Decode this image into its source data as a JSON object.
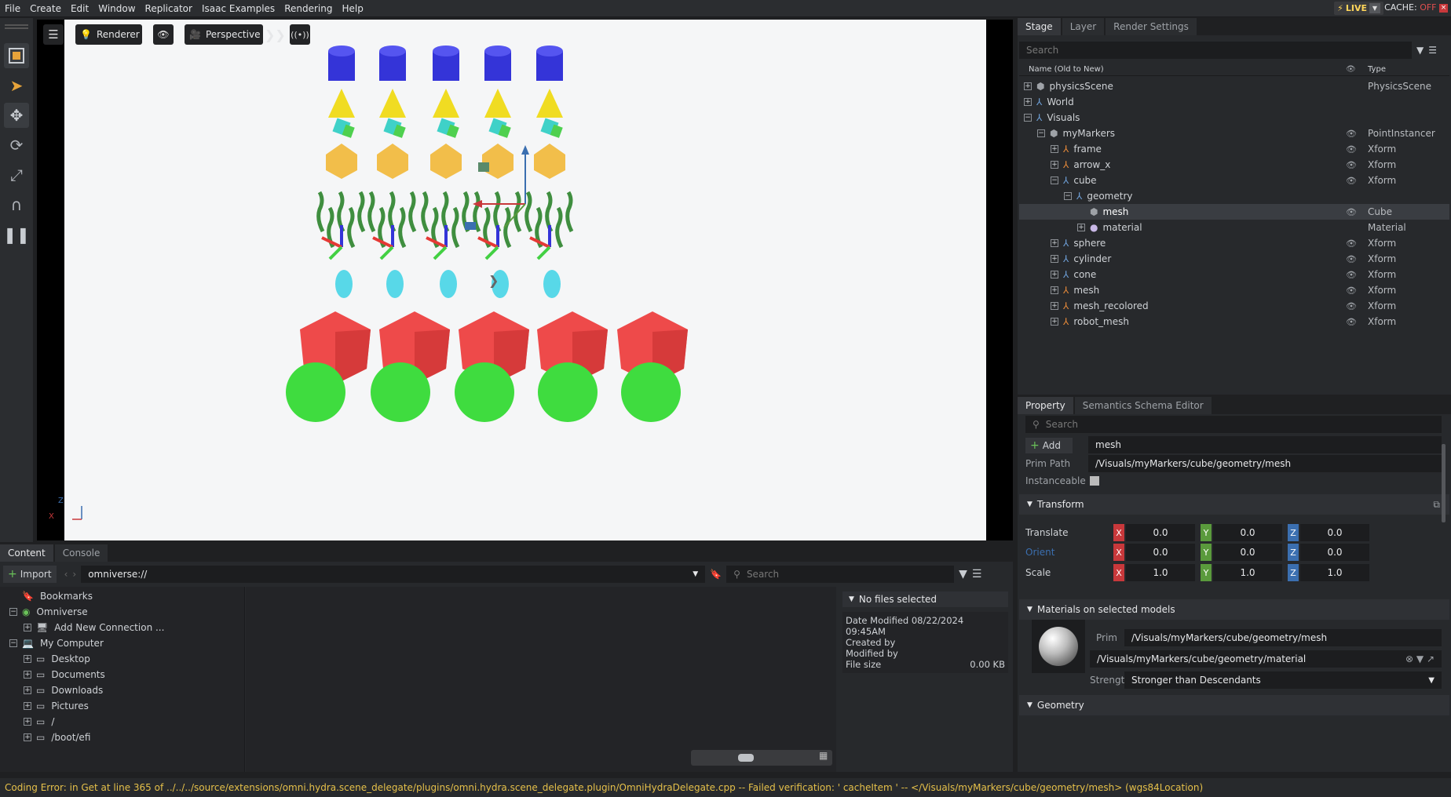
{
  "menu": [
    "File",
    "Create",
    "Edit",
    "Window",
    "Replicator",
    "Isaac Examples",
    "Rendering",
    "Help"
  ],
  "live": {
    "label": "LIVE"
  },
  "cache": {
    "label": "CACHE:",
    "state": "OFF"
  },
  "viewport": {
    "renderer_label": "Renderer",
    "camera_label": "Perspective",
    "axis_x": "X",
    "axis_z": "Z"
  },
  "content": {
    "tabs": [
      "Content",
      "Console"
    ],
    "import_label": "Import",
    "path_value": "omniverse://",
    "search_placeholder": "Search",
    "tree": [
      {
        "label": "Bookmarks",
        "indent": 0,
        "expander": "",
        "icon": "bookmark-icon"
      },
      {
        "label": "Omniverse",
        "indent": 0,
        "expander": "−",
        "icon": "omniverse-icon"
      },
      {
        "label": "Add New Connection ...",
        "indent": 1,
        "expander": "+",
        "icon": "server-icon"
      },
      {
        "label": "My Computer",
        "indent": 0,
        "expander": "−",
        "icon": "computer-icon"
      },
      {
        "label": "Desktop",
        "indent": 1,
        "expander": "+",
        "icon": "drive-icon"
      },
      {
        "label": "Documents",
        "indent": 1,
        "expander": "+",
        "icon": "drive-icon"
      },
      {
        "label": "Downloads",
        "indent": 1,
        "expander": "+",
        "icon": "drive-icon"
      },
      {
        "label": "Pictures",
        "indent": 1,
        "expander": "+",
        "icon": "drive-icon"
      },
      {
        "label": "/",
        "indent": 1,
        "expander": "+",
        "icon": "drive-icon"
      },
      {
        "label": "/boot/efi",
        "indent": 1,
        "expander": "+",
        "icon": "drive-icon"
      }
    ],
    "info": {
      "title": "No files selected",
      "date_modified": "Date Modified 08/22/2024 09:45AM",
      "created_by": "Created by",
      "modified_by": "Modified by",
      "file_size_label": "File size",
      "file_size_value": "0.00 KB"
    }
  },
  "stage": {
    "tabs": [
      "Stage",
      "Layer",
      "Render Settings"
    ],
    "search_placeholder": "Search",
    "col_name": "Name (Old to New)",
    "col_type": "Type",
    "rows": [
      {
        "name": "physicsScene",
        "type": "PhysicsScene",
        "indent": 0,
        "expander": "+",
        "icon": "prim-icon",
        "eye": false,
        "selected": false
      },
      {
        "name": "World",
        "type": "",
        "indent": 0,
        "expander": "+",
        "icon": "xform-icon",
        "eye": false,
        "selected": false
      },
      {
        "name": "Visuals",
        "type": "",
        "indent": 0,
        "expander": "−",
        "icon": "xform-icon",
        "eye": false,
        "selected": false
      },
      {
        "name": "myMarkers",
        "type": "PointInstancer",
        "indent": 1,
        "expander": "−",
        "icon": "prim-icon",
        "eye": true,
        "selected": false
      },
      {
        "name": "frame",
        "type": "Xform",
        "indent": 2,
        "expander": "+",
        "icon": "xform-orange-icon",
        "eye": true,
        "selected": false
      },
      {
        "name": "arrow_x",
        "type": "Xform",
        "indent": 2,
        "expander": "+",
        "icon": "xform-orange-icon",
        "eye": true,
        "selected": false
      },
      {
        "name": "cube",
        "type": "Xform",
        "indent": 2,
        "expander": "−",
        "icon": "xform-icon",
        "eye": true,
        "selected": false
      },
      {
        "name": "geometry",
        "type": "",
        "indent": 3,
        "expander": "−",
        "icon": "xform-icon",
        "eye": false,
        "selected": false
      },
      {
        "name": "mesh",
        "type": "Cube",
        "indent": 4,
        "expander": "",
        "icon": "mesh-icon",
        "eye": true,
        "selected": true
      },
      {
        "name": "material",
        "type": "Material",
        "indent": 4,
        "expander": "+",
        "icon": "material-icon",
        "eye": false,
        "selected": false
      },
      {
        "name": "sphere",
        "type": "Xform",
        "indent": 2,
        "expander": "+",
        "icon": "xform-icon",
        "eye": true,
        "selected": false
      },
      {
        "name": "cylinder",
        "type": "Xform",
        "indent": 2,
        "expander": "+",
        "icon": "xform-icon",
        "eye": true,
        "selected": false
      },
      {
        "name": "cone",
        "type": "Xform",
        "indent": 2,
        "expander": "+",
        "icon": "xform-icon",
        "eye": true,
        "selected": false
      },
      {
        "name": "mesh",
        "type": "Xform",
        "indent": 2,
        "expander": "+",
        "icon": "xform-orange-icon",
        "eye": true,
        "selected": false
      },
      {
        "name": "mesh_recolored",
        "type": "Xform",
        "indent": 2,
        "expander": "+",
        "icon": "xform-orange-icon",
        "eye": true,
        "selected": false
      },
      {
        "name": "robot_mesh",
        "type": "Xform",
        "indent": 2,
        "expander": "+",
        "icon": "xform-orange-icon",
        "eye": true,
        "selected": false
      }
    ]
  },
  "property": {
    "tabs": [
      "Property",
      "Semantics Schema Editor"
    ],
    "search_placeholder": "Search",
    "add_label": "Add",
    "name_value": "mesh",
    "prim_path_label": "Prim Path",
    "prim_path_value": "/Visuals/myMarkers/cube/geometry/mesh",
    "instanceable_label": "Instanceable",
    "transform_label": "Transform",
    "translate": {
      "label": "Translate",
      "x": "0.0",
      "y": "0.0",
      "z": "0.0"
    },
    "orient": {
      "label": "Orient",
      "x": "0.0",
      "y": "0.0",
      "z": "0.0"
    },
    "scale": {
      "label": "Scale",
      "x": "1.0",
      "y": "1.0",
      "z": "1.0"
    },
    "axis_x": "X",
    "axis_y": "Y",
    "axis_z": "Z",
    "materials_label": "Materials on selected models",
    "prim_label": "Prim",
    "material_prim_value": "/Visuals/myMarkers/cube/geometry/mesh",
    "material_path_value": "/Visuals/myMarkers/cube/geometry/material",
    "strength_label": "Strength",
    "strength_value": "Stronger than Descendants",
    "geometry_label": "Geometry"
  },
  "status": {
    "message": "Coding Error: in Get at line 365 of ../../../source/extensions/omni.hydra.scene_delegate/plugins/omni.hydra.scene_delegate.plugin/OmniHydraDelegate.cpp -- Failed verification: ' cacheItem ' -- </Visuals/myMarkers/cube/geometry/mesh> (wgs84Location)"
  },
  "colors": {
    "panel_bg": "#27292c",
    "accent_blue": "#3b6fb0",
    "axis_x": "#c8383b",
    "axis_y": "#5a9a3c",
    "axis_z": "#3b6fb0",
    "status_text": "#e5c04a",
    "live_yellow": "#ffd65a",
    "cache_off": "#e04f4f"
  }
}
